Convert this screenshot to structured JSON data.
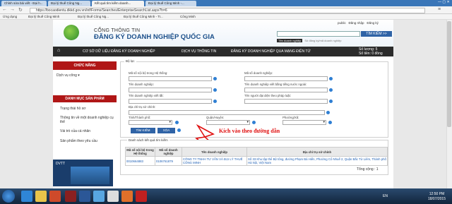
{
  "browser": {
    "tabs": [
      "Chỉnh sửa bài viết - Đại h...",
      "Đại lý thuế Công Ng...",
      "Kết quả tìm kiếm doanh...",
      "Đại lý thuế Công Minh -..."
    ],
    "url": "https://bocaodientu.dkkd.gov.vn/inf/Forms/Searches/EnterpriseSearchList.aspx?h=6",
    "bookmarks": [
      "Ứng dụng",
      "Đại lý thuế Công Minh",
      "Đại lý thuế Công Ng...",
      "Đại lý thuế Công Minh - Tr...",
      "Công Minh"
    ]
  },
  "header": {
    "portal_line1": "CỔNG THÔNG TIN",
    "portal_line2": "ĐĂNG KÝ DOANH NGHIỆP QUỐC GIA",
    "links": [
      "public",
      "Đăng nhập",
      "Đăng ký"
    ],
    "search_button": "TÌM KIẾM >>",
    "search_options": [
      "Tên doanh nghiệp",
      "Số đăng ký/mã doanh nghiệp"
    ]
  },
  "menu": [
    "CƠ SỞ DỮ LIỆU ĐĂNG KÝ DOANH NGHIỆP",
    "DỊCH VỤ THÔNG TIN",
    "ĐĂNG KÝ DOANH NGHIỆP QUA MẠNG ĐIỆN TỬ"
  ],
  "stats": {
    "line1": "Số lượng: 5",
    "line2": "Số tiền: 0 đồng"
  },
  "sidebar": {
    "section1": "CHỨC NĂNG",
    "section1_items": [
      "Dịch vụ công"
    ],
    "section2": "DANH MỤC SẢN PHẨM",
    "section2_items": [
      "Trạng thái hồ sơ",
      "Thông tin về một doanh nghiệp cụ thể",
      "Vài trò của cá nhân",
      "Sản phẩm theo yêu cầu"
    ],
    "video_label": "DVTT"
  },
  "filter": {
    "legend": "Bộ lọc",
    "labels": [
      "Mã số nội bộ trong Hệ thống:",
      "Mã số doanh nghiệp:",
      "Tên doanh nghiệp:",
      "Tên doanh nghiệp viết bằng tiếng nước ngoài:",
      "Tên doanh nghiệp viết tắt:",
      "Tên người đại diện theo pháp luật:",
      "Địa chỉ trụ sở chính:",
      "Tỉnh/Thành phố:",
      "Quận/Huyện:",
      "Phường/Xã:"
    ],
    "search_button": "TÌM KIẾM",
    "clear_button": "XÓA"
  },
  "annotation": "Kích vào theo đường dẫn",
  "results": {
    "legend": "Danh sách kết quả tìm kiếm",
    "headers": [
      "Mã số nội bộ trong Hệ thống",
      "Mã số doanh nghiệp",
      "Tên doanh nghiệp",
      "Địa chỉ trụ sở chính"
    ],
    "rows": [
      [
        "0010664883",
        "0106761879",
        "CÔNG TY TNHH TƯ VẤN VÀ ĐẠI LÝ THUẾ CÔNG MINH",
        "Số 33 Khu tập thể Bệ tông, đường Phạm Bá Hiến, Phường Cổ Nhuế 2, Quận Bắc Từ Liêm, Thành phố Hà Nội, Việt Nam"
      ]
    ],
    "total": "Tổng cộng : 1"
  },
  "taskbar": {
    "lang": "EN",
    "time": "12:50 PM",
    "date": "18/07/2015"
  }
}
